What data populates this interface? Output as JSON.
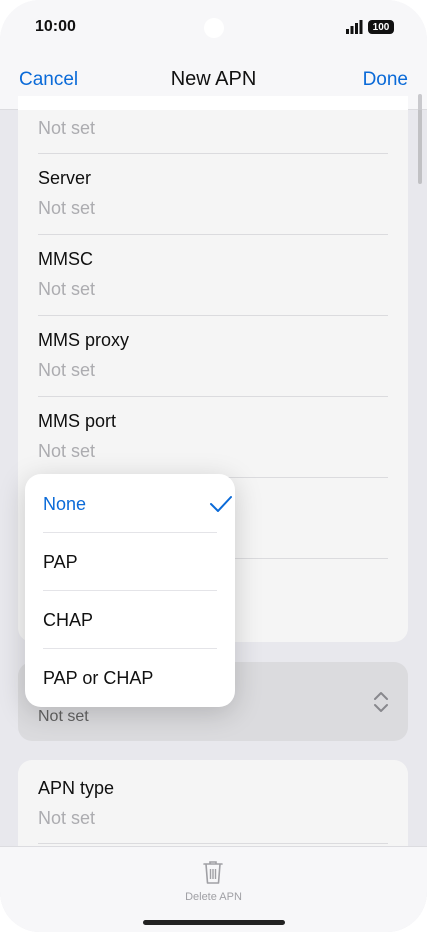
{
  "status": {
    "time": "10:00",
    "battery": "100"
  },
  "nav": {
    "cancel": "Cancel",
    "title": "New APN",
    "done": "Done"
  },
  "fields": [
    {
      "label": "",
      "value": "Not set"
    },
    {
      "label": "Server",
      "value": "Not set"
    },
    {
      "label": "MMSC",
      "value": "Not set"
    },
    {
      "label": "MMS proxy",
      "value": "Not set"
    },
    {
      "label": "MMS port",
      "value": "Not set"
    }
  ],
  "auth_field": {
    "value": "Not set"
  },
  "apn_type": {
    "label": "APN type",
    "value": "Not set"
  },
  "auth_menu": {
    "options": [
      "None",
      "PAP",
      "CHAP",
      "PAP or CHAP"
    ],
    "selected": "None"
  },
  "bottom": {
    "delete_label": "Delete APN"
  },
  "colors": {
    "accent": "#0a6ad8",
    "placeholder": "#b4b4b8"
  },
  "icons": [
    "signal-icon",
    "battery-icon",
    "checkmark-icon",
    "updown-chevron-icon",
    "trash-icon"
  ]
}
